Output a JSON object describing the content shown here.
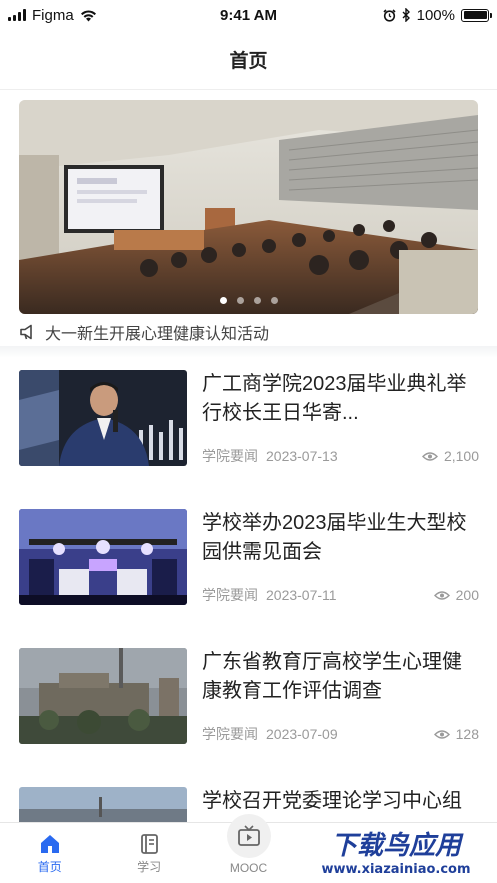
{
  "status_bar": {
    "carrier": "Figma",
    "time": "9:41 AM",
    "battery": "100%"
  },
  "nav": {
    "title": "首页"
  },
  "banner": {
    "dot_count": 4,
    "active_dot": 0
  },
  "notice": {
    "icon": "megaphone-icon",
    "text": "大一新生开展心理健康认知活动"
  },
  "news": [
    {
      "title": "广工商学院2023届毕业典礼举行校长王日华寄...",
      "category": "学院要闻",
      "date": "2023-07-13",
      "views": "2,100"
    },
    {
      "title": "学校举办2023届毕业生大型校园供需见面会",
      "category": "学院要闻",
      "date": "2023-07-11",
      "views": "200"
    },
    {
      "title": "广东省教育厅高校学生心理健康教育工作评估调查",
      "category": "学院要闻",
      "date": "2023-07-09",
      "views": "128"
    },
    {
      "title": "学校召开党委理论学习中心组"
    }
  ],
  "tabs": [
    {
      "label": "首页",
      "icon": "home-icon",
      "active": true
    },
    {
      "label": "学习",
      "icon": "book-icon",
      "active": false
    },
    {
      "label": "MOOC",
      "icon": "tv-icon",
      "active": false
    }
  ],
  "watermark": {
    "text": "下载鸟应用",
    "url": "www.xiazainiao.com"
  },
  "colors": {
    "accent": "#2a6af0",
    "meta": "#9a9a9a"
  }
}
